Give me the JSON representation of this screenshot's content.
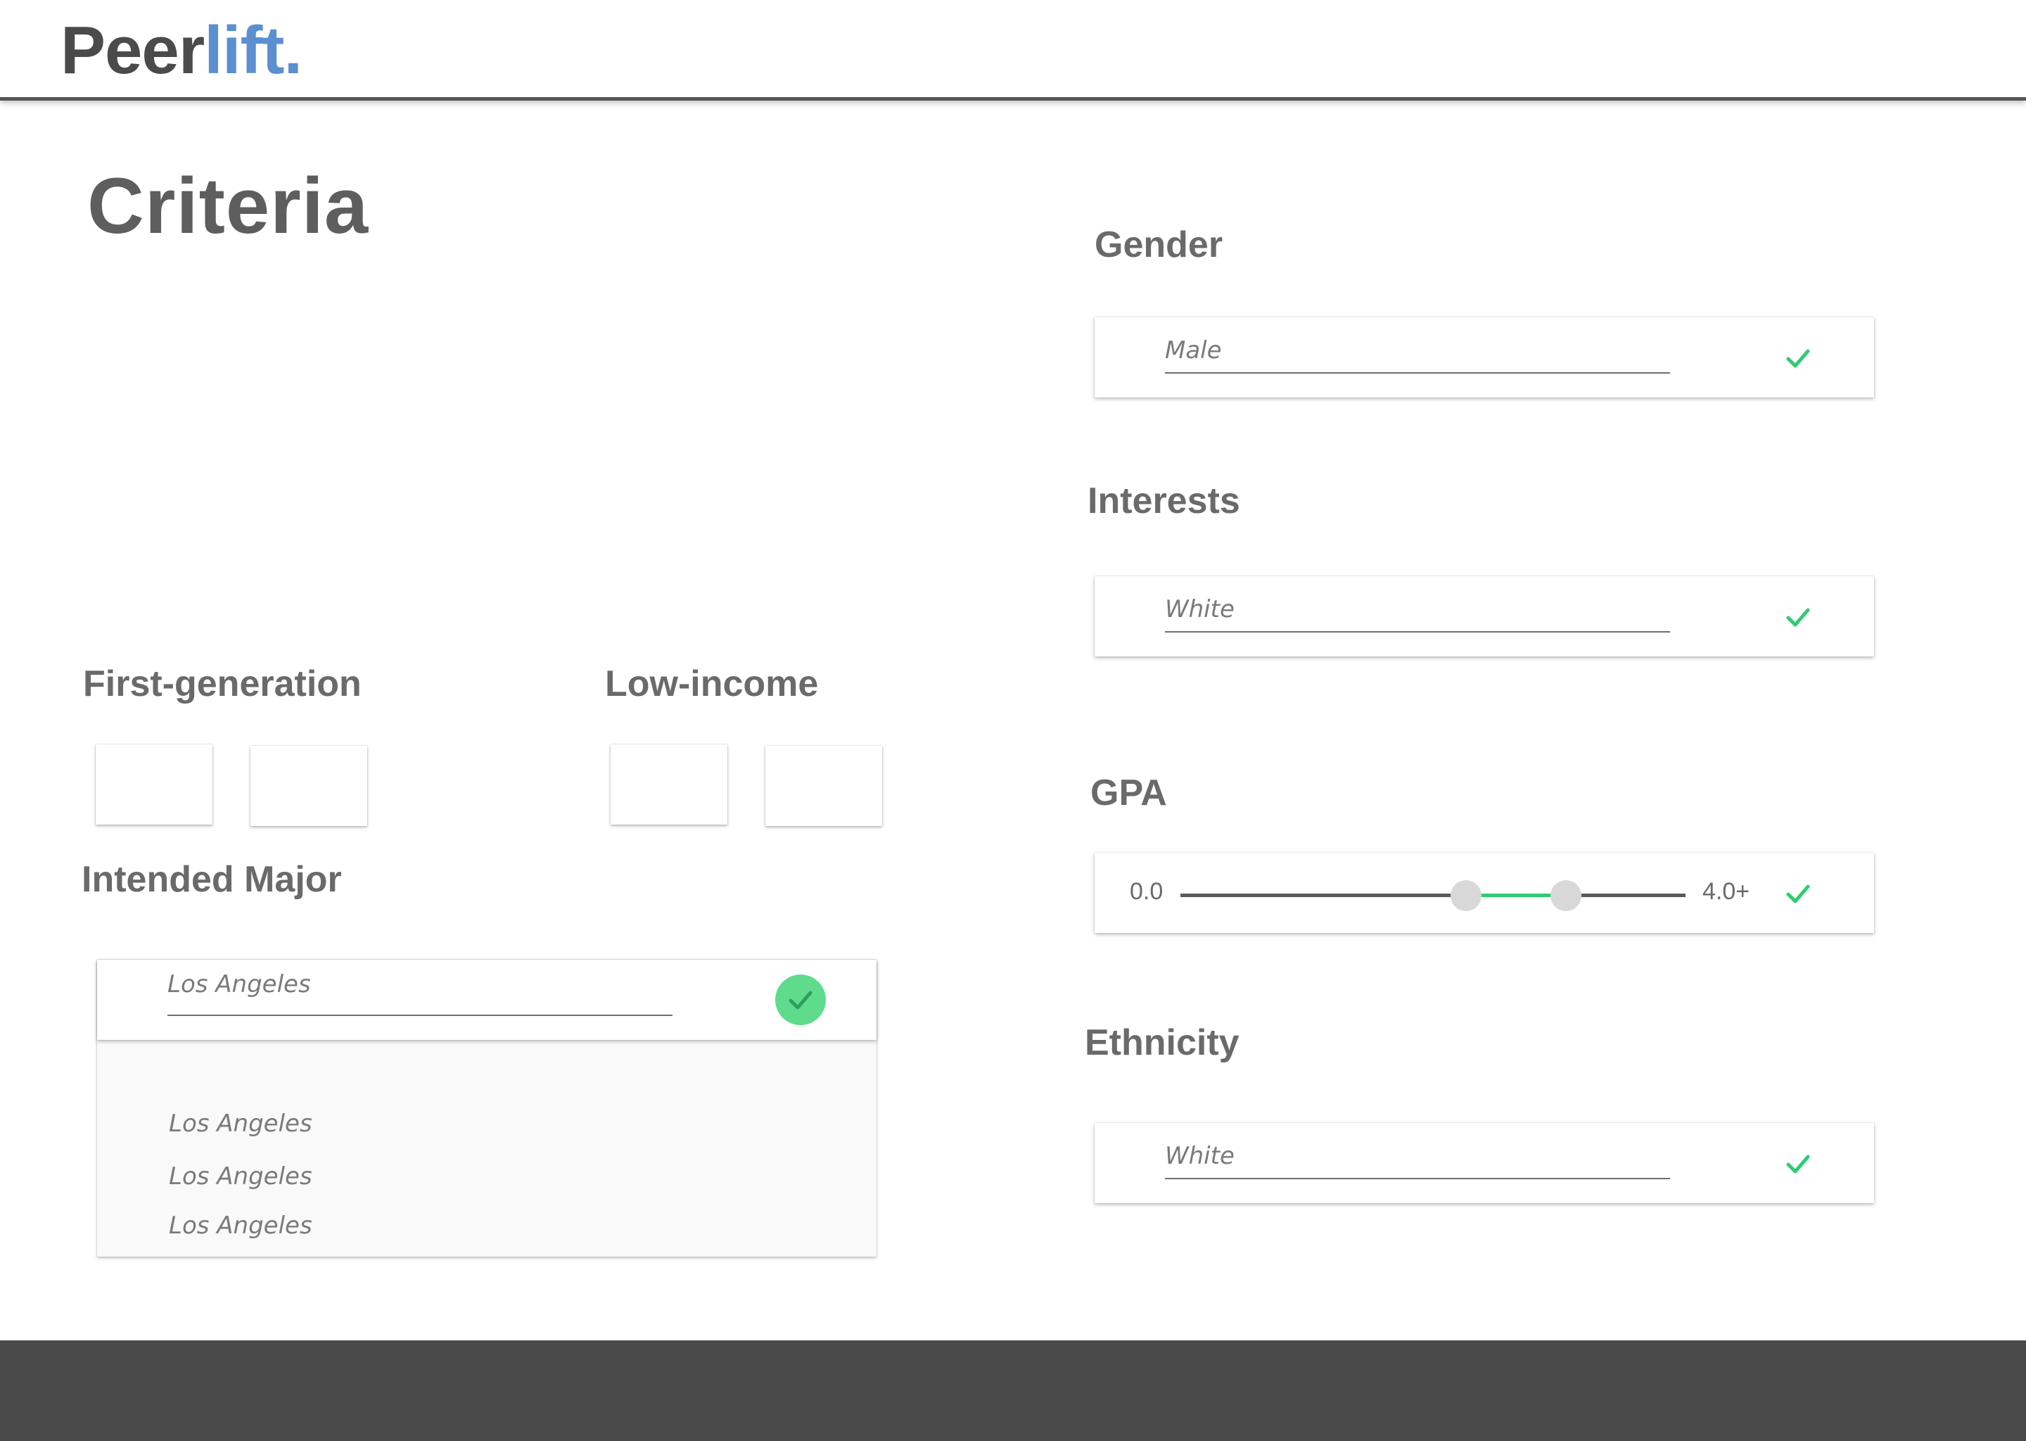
{
  "brand": {
    "name_part1": "Peer",
    "name_part2": "lift.",
    "accent": "#5b8fd0"
  },
  "page": {
    "title": "Criteria"
  },
  "gender": {
    "label": "Gender",
    "value": "Male",
    "status_icon": "check-icon"
  },
  "interests": {
    "label": "Interests",
    "value": "White",
    "status_icon": "check-icon"
  },
  "gpa": {
    "label": "GPA",
    "min_label": "0.0",
    "max_label": "4.0+",
    "range_low": 2.3,
    "range_high": 3.1,
    "status_icon": "check-icon"
  },
  "ethnicity": {
    "label": "Ethnicity",
    "value": "White",
    "status_icon": "check-icon"
  },
  "first_generation": {
    "label": "First-generation",
    "options": [
      "",
      ""
    ]
  },
  "low_income": {
    "label": "Low-income",
    "options": [
      "",
      ""
    ]
  },
  "intended_major": {
    "label": "Intended Major",
    "value": "Los Angeles",
    "status_icon": "check-circle-icon",
    "suggestions": [
      "Los Angeles",
      "Los Angeles",
      "Los Angeles"
    ]
  },
  "colors": {
    "check_green": "#2ecc71",
    "check_circle_bg": "#5edc8c",
    "footer_bg": "#4a4a4a"
  }
}
